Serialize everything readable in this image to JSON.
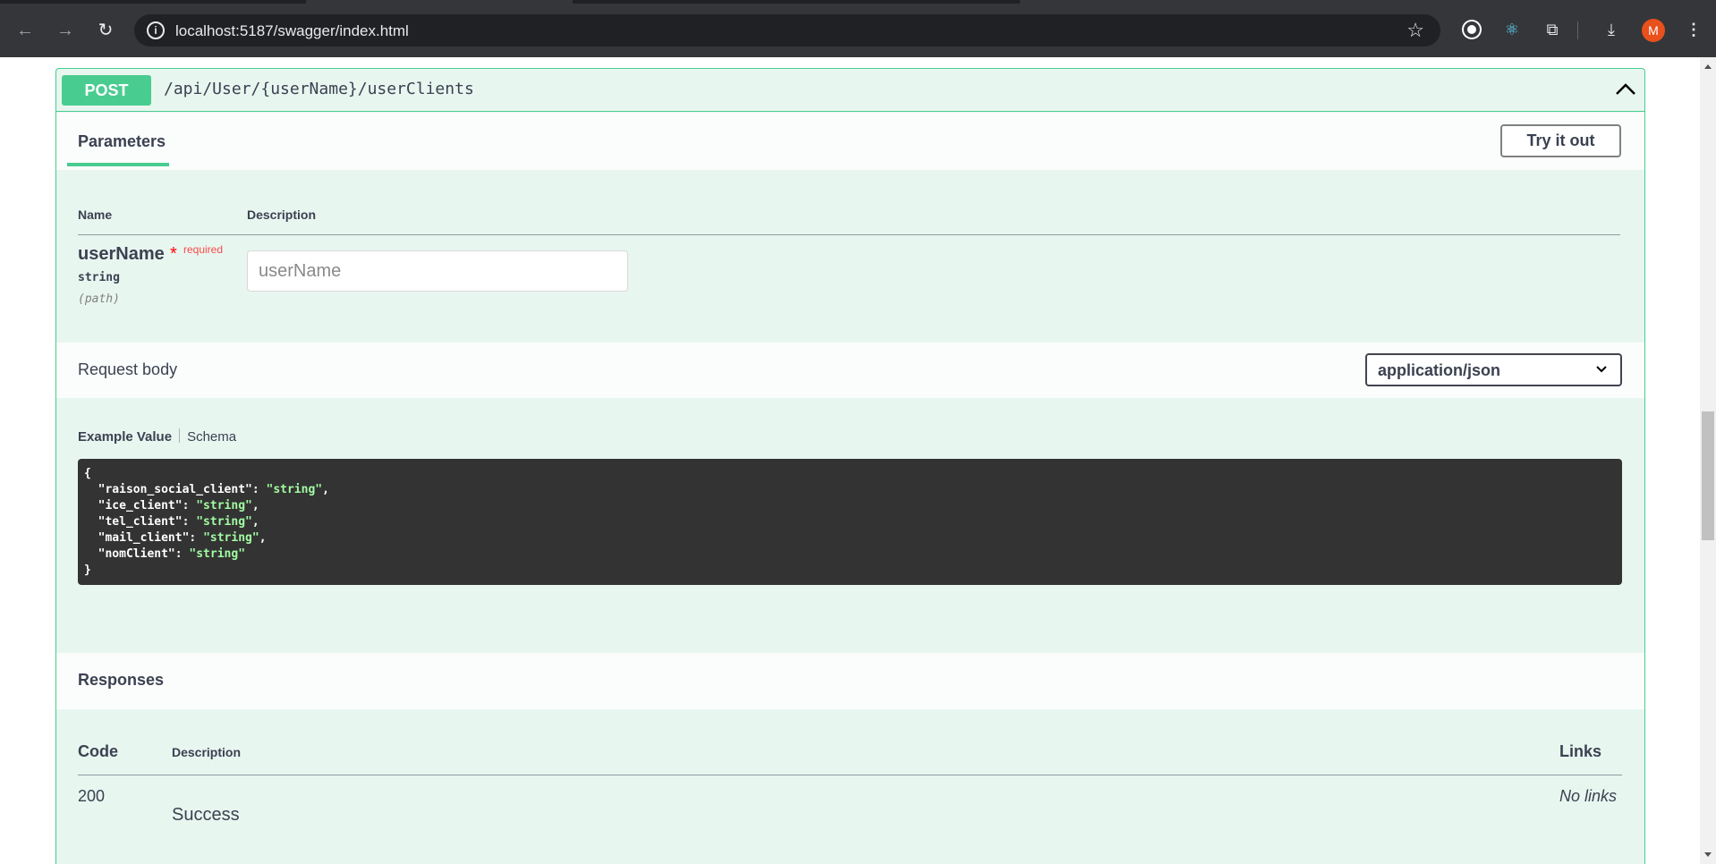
{
  "browser": {
    "url": "localhost:5187/swagger/index.html",
    "back_icon": "arrow-left-icon",
    "forward_icon": "arrow-right-icon",
    "reload_icon": "reload-icon",
    "profile_initial": "M",
    "profile_color": "#e8501c"
  },
  "operation": {
    "method": "POST",
    "path": "/api/User/{userName}/userClients",
    "method_color": "#49cc90"
  },
  "parameters": {
    "tab_label": "Parameters",
    "try_button": "Try it out",
    "col_name": "Name",
    "col_description": "Description",
    "items": [
      {
        "name": "userName",
        "required_star": "*",
        "required_label": "required",
        "type": "string",
        "in": "(path)",
        "placeholder": "userName"
      }
    ]
  },
  "request_body": {
    "title": "Request body",
    "content_type": "application/json",
    "tab_example": "Example Value",
    "tab_schema": "Schema",
    "example_lines": [
      {
        "key": "\"raison_social_client\"",
        "value": "\"string\"",
        "trail": ","
      },
      {
        "key": "\"ice_client\"",
        "value": "\"string\"",
        "trail": ","
      },
      {
        "key": "\"tel_client\"",
        "value": "\"string\"",
        "trail": ","
      },
      {
        "key": "\"mail_client\"",
        "value": "\"string\"",
        "trail": ","
      },
      {
        "key": "\"nomClient\"",
        "value": "\"string\"",
        "trail": ""
      }
    ],
    "open_brace": "{",
    "close_brace": "}"
  },
  "responses": {
    "title": "Responses",
    "col_code": "Code",
    "col_description": "Description",
    "col_links": "Links",
    "rows": [
      {
        "code": "200",
        "description": "Success",
        "links": "No links"
      }
    ]
  }
}
